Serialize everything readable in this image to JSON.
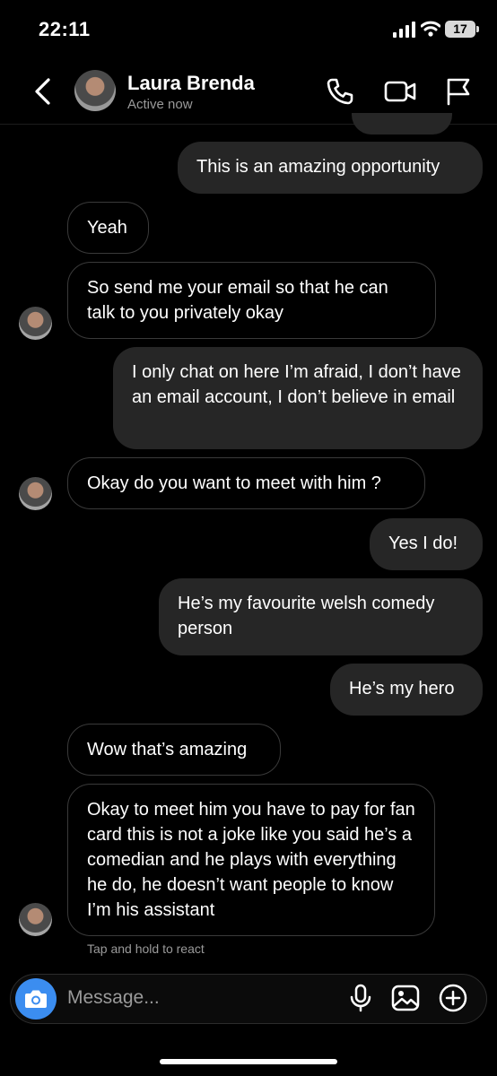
{
  "status_bar": {
    "time": "22:11",
    "battery": "17"
  },
  "header": {
    "contact_name": "Laura Brenda",
    "contact_status": "Active now",
    "icons": [
      "back-icon",
      "phone-icon",
      "video-call-icon",
      "flag-icon"
    ]
  },
  "messages": [
    {
      "from": "me",
      "text": "This is an amazing opportunity"
    },
    {
      "from": "them",
      "text": "Yeah"
    },
    {
      "from": "them",
      "text": "So send me your email so that he can talk to you privately okay"
    },
    {
      "from": "me",
      "text": "I only chat on here I’m afraid, I don’t have an email account, I don’t believe in email"
    },
    {
      "from": "them",
      "text": "Okay do you want to meet with him ?"
    },
    {
      "from": "me",
      "text": "Yes I do!"
    },
    {
      "from": "me",
      "text": "He’s my favourite welsh comedy person"
    },
    {
      "from": "me",
      "text": "He’s my hero"
    },
    {
      "from": "them",
      "text": "Wow that’s amazing"
    },
    {
      "from": "them",
      "text": "Okay to meet him you have to pay for fan card this is not a joke like you said he’s a comedian and he plays with everything he do, he doesn’t want people to know I’m his assistant"
    }
  ],
  "react_hint": "Tap and hold to react",
  "composer": {
    "placeholder": "Message...",
    "icons": [
      "camera-icon",
      "microphone-icon",
      "gallery-icon",
      "add-icon"
    ]
  },
  "colors": {
    "outgoing_bubble": "#262626",
    "incoming_border": "#3a3a3a",
    "camera_button": "#3b8df0",
    "background": "#000000"
  }
}
